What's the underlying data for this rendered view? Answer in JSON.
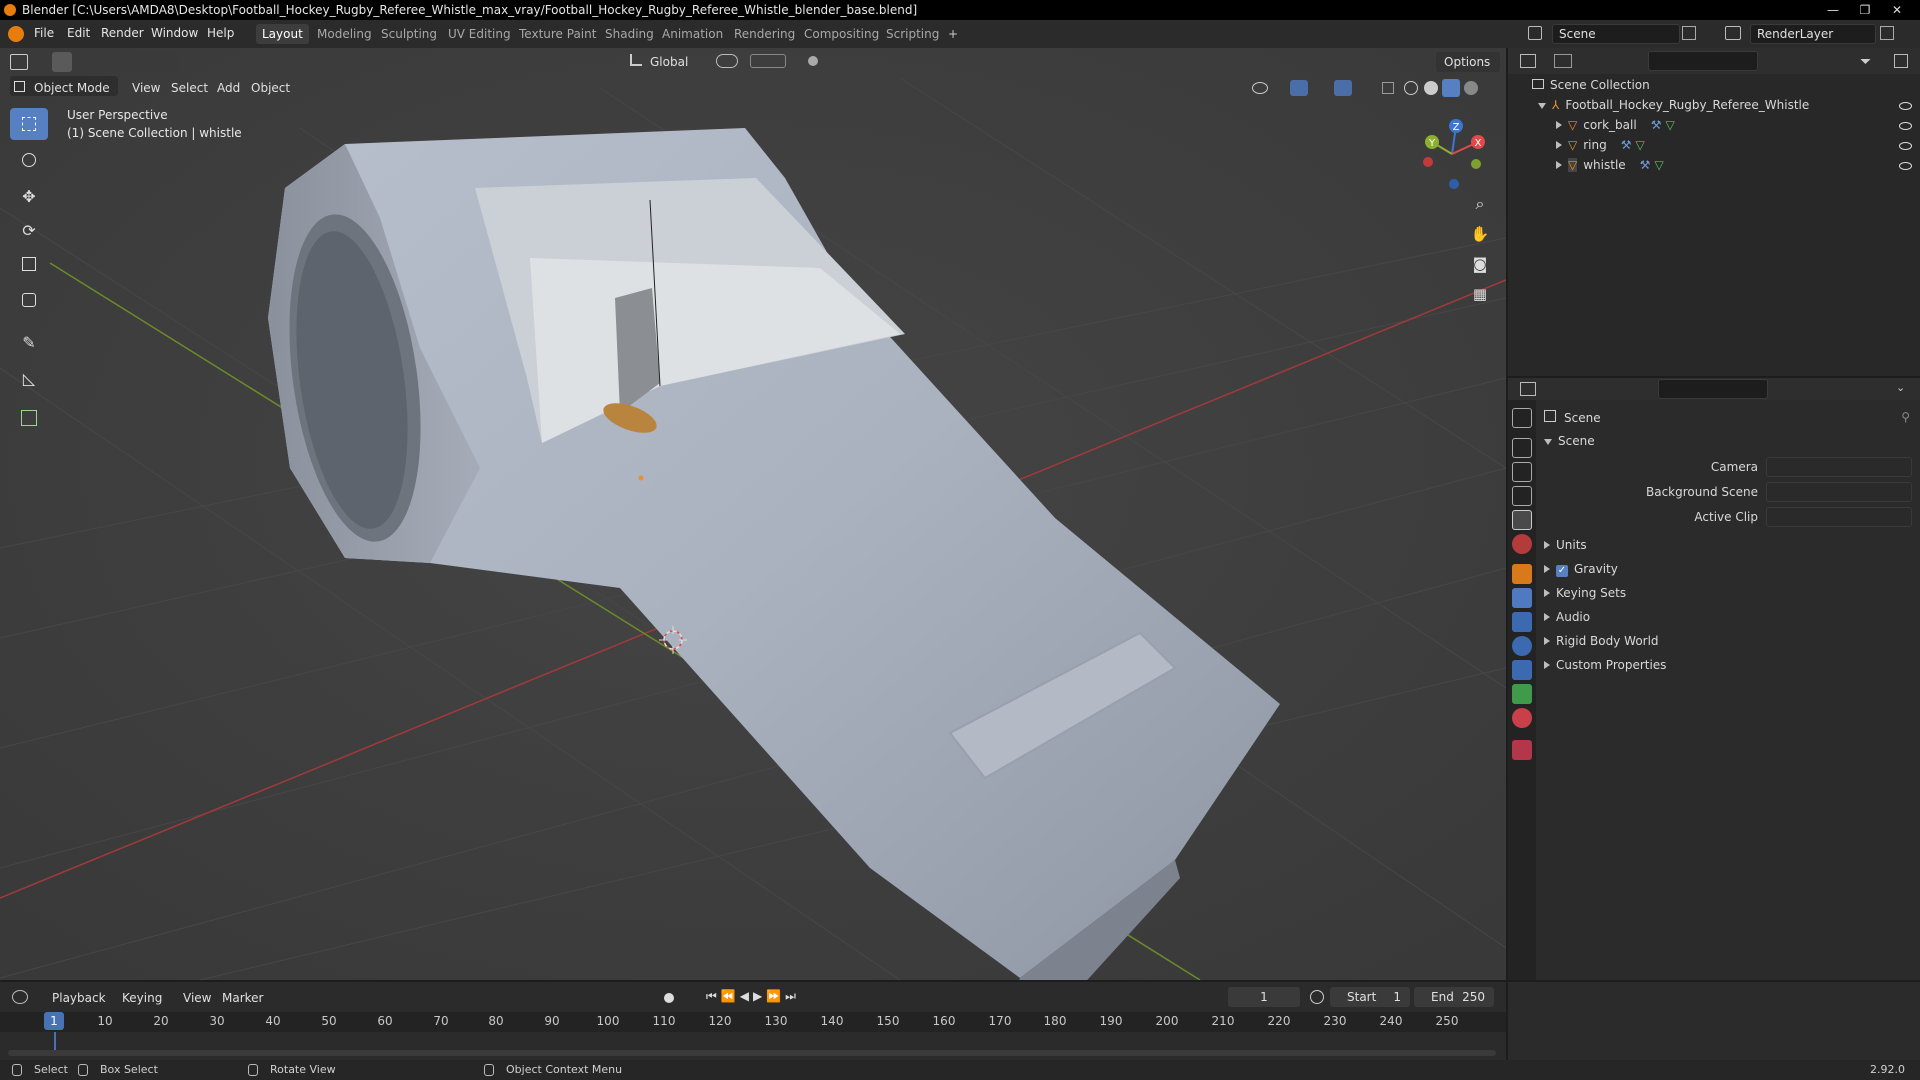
{
  "window": {
    "title": "Blender [C:\\Users\\AMDA8\\Desktop\\Football_Hockey_Rugby_Referee_Whistle_max_vray/Football_Hockey_Rugby_Referee_Whistle_blender_base.blend]",
    "minimize": "—",
    "maximize": "❐",
    "close": "✕"
  },
  "menubar": {
    "items": [
      "File",
      "Edit",
      "Render",
      "Window",
      "Help"
    ],
    "workspaces": [
      "Layout",
      "Modeling",
      "Sculpting",
      "UV Editing",
      "Texture Paint",
      "Shading",
      "Animation",
      "Rendering",
      "Compositing",
      "Scripting"
    ],
    "add_workspace": "+",
    "scene": "Scene",
    "render_layer": "RenderLayer"
  },
  "viewport_header": {
    "mode": "Object Mode",
    "menus": [
      "View",
      "Select",
      "Add",
      "Object"
    ],
    "transform_orientation": "Global",
    "options": "Options"
  },
  "viewport": {
    "perspective": "User Perspective",
    "collection_info": "(1) Scene Collection | whistle",
    "gizmo": {
      "x": "X",
      "y": "Y",
      "z": "Z"
    }
  },
  "outliner": {
    "root": "Scene Collection",
    "collection": "Football_Hockey_Rugby_Referee_Whistle",
    "objects": [
      "cork_ball",
      "ring",
      "whistle"
    ]
  },
  "properties": {
    "context": "Scene",
    "panel_title": "Scene",
    "fields": [
      {
        "label": "Camera",
        "value": ""
      },
      {
        "label": "Background Scene",
        "value": ""
      },
      {
        "label": "Active Clip",
        "value": ""
      }
    ],
    "subpanels": [
      "Units",
      "Gravity",
      "Keying Sets",
      "Audio",
      "Rigid Body World",
      "Custom Properties"
    ],
    "gravity_checked": true
  },
  "timeline": {
    "menus": [
      "Playback",
      "Keying",
      "View",
      "Marker"
    ],
    "current_frame": "1",
    "start_label": "Start",
    "start": "1",
    "end_label": "End",
    "end": "250",
    "ticks": [
      "1",
      "10",
      "20",
      "30",
      "40",
      "50",
      "60",
      "70",
      "80",
      "90",
      "100",
      "110",
      "120",
      "130",
      "140",
      "150",
      "160",
      "170",
      "180",
      "190",
      "200",
      "210",
      "220",
      "230",
      "240",
      "250"
    ]
  },
  "statusbar": {
    "select": "Select",
    "box_select": "Box Select",
    "rotate_view": "Rotate View",
    "context_menu": "Object Context Menu",
    "version": "2.92.0"
  },
  "colors": {
    "accent": "#5680c2",
    "blender_orange": "#e87d0d",
    "axis_x": "#e24a4a",
    "axis_y": "#8cb02d",
    "axis_z": "#3c76d1"
  }
}
